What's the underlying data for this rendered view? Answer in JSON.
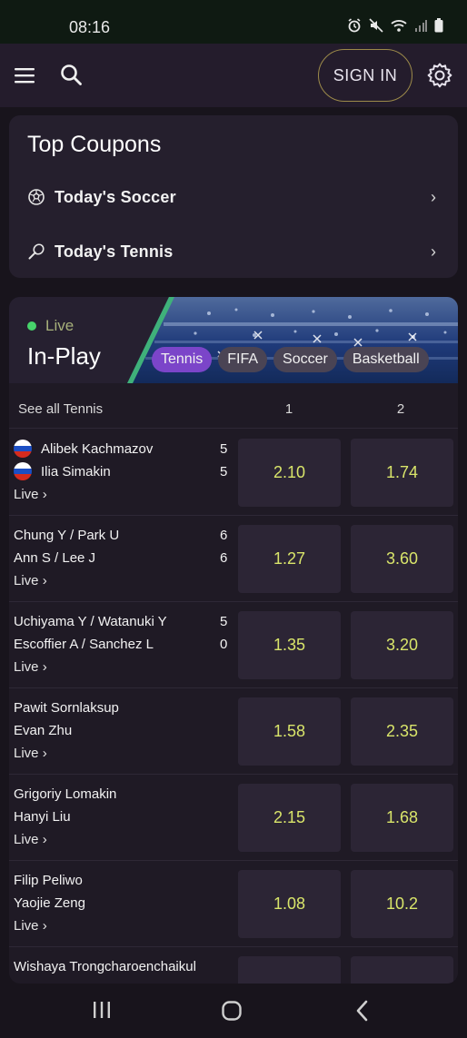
{
  "status_bar": {
    "time": "08:16",
    "icons": [
      "alarm-icon",
      "mute-icon",
      "wifi-icon",
      "signal-icon",
      "battery-icon"
    ]
  },
  "app_bar": {
    "icons": [
      "menu-icon",
      "search-icon",
      "gear-icon"
    ],
    "sign_in_label": "SIGN IN"
  },
  "top_coupons": {
    "title": "Top Coupons",
    "items": [
      {
        "icon": "soccer-ball-icon",
        "label": "Today's Soccer"
      },
      {
        "icon": "tennis-racket-icon",
        "label": "Today's Tennis"
      }
    ]
  },
  "in_play": {
    "live_label": "Live",
    "title": "In-Play",
    "tabs": [
      "Tennis",
      "FIFA",
      "Soccer",
      "Basketball"
    ],
    "active_tab": "Tennis",
    "see_all_label": "See all Tennis",
    "col_1": "1",
    "col_2": "2",
    "live_link_label": "Live",
    "matches": [
      {
        "player1": "Alibek Kachmazov",
        "player2": "Ilia Simakin",
        "flag": "russia",
        "score1": "5",
        "score2": "5",
        "odd1": "2.10",
        "odd2": "1.74"
      },
      {
        "player1": "Chung Y / Park U",
        "player2": "Ann S / Lee J",
        "flag": "",
        "score1": "6",
        "score2": "6",
        "odd1": "1.27",
        "odd2": "3.60"
      },
      {
        "player1": "Uchiyama Y / Watanuki Y",
        "player2": "Escoffier A / Sanchez L",
        "flag": "",
        "score1": "5",
        "score2": "0",
        "odd1": "1.35",
        "odd2": "3.20"
      },
      {
        "player1": "Pawit Sornlaksup",
        "player2": "Evan Zhu",
        "flag": "",
        "score1": "",
        "score2": "",
        "odd1": "1.58",
        "odd2": "2.35"
      },
      {
        "player1": "Grigoriy Lomakin",
        "player2": "Hanyi Liu",
        "flag": "",
        "score1": "",
        "score2": "",
        "odd1": "2.15",
        "odd2": "1.68"
      },
      {
        "player1": "Filip Peliwo",
        "player2": "Yaojie Zeng",
        "flag": "",
        "score1": "",
        "score2": "",
        "odd1": "1.08",
        "odd2": "10.2"
      },
      {
        "player1": "Wishaya Trongcharoenchaikul",
        "player2": "",
        "flag": "",
        "score1": "",
        "score2": "",
        "odd1": "",
        "odd2": ""
      }
    ]
  },
  "nav_bar": {
    "icons": [
      "recent-apps-icon",
      "home-icon",
      "back-icon"
    ]
  },
  "colors": {
    "background": "#18141c",
    "card": "#251f2d",
    "accent_purple": "#7b45c9",
    "odds_text": "#d9e56a",
    "live_dot": "#47d36b"
  }
}
